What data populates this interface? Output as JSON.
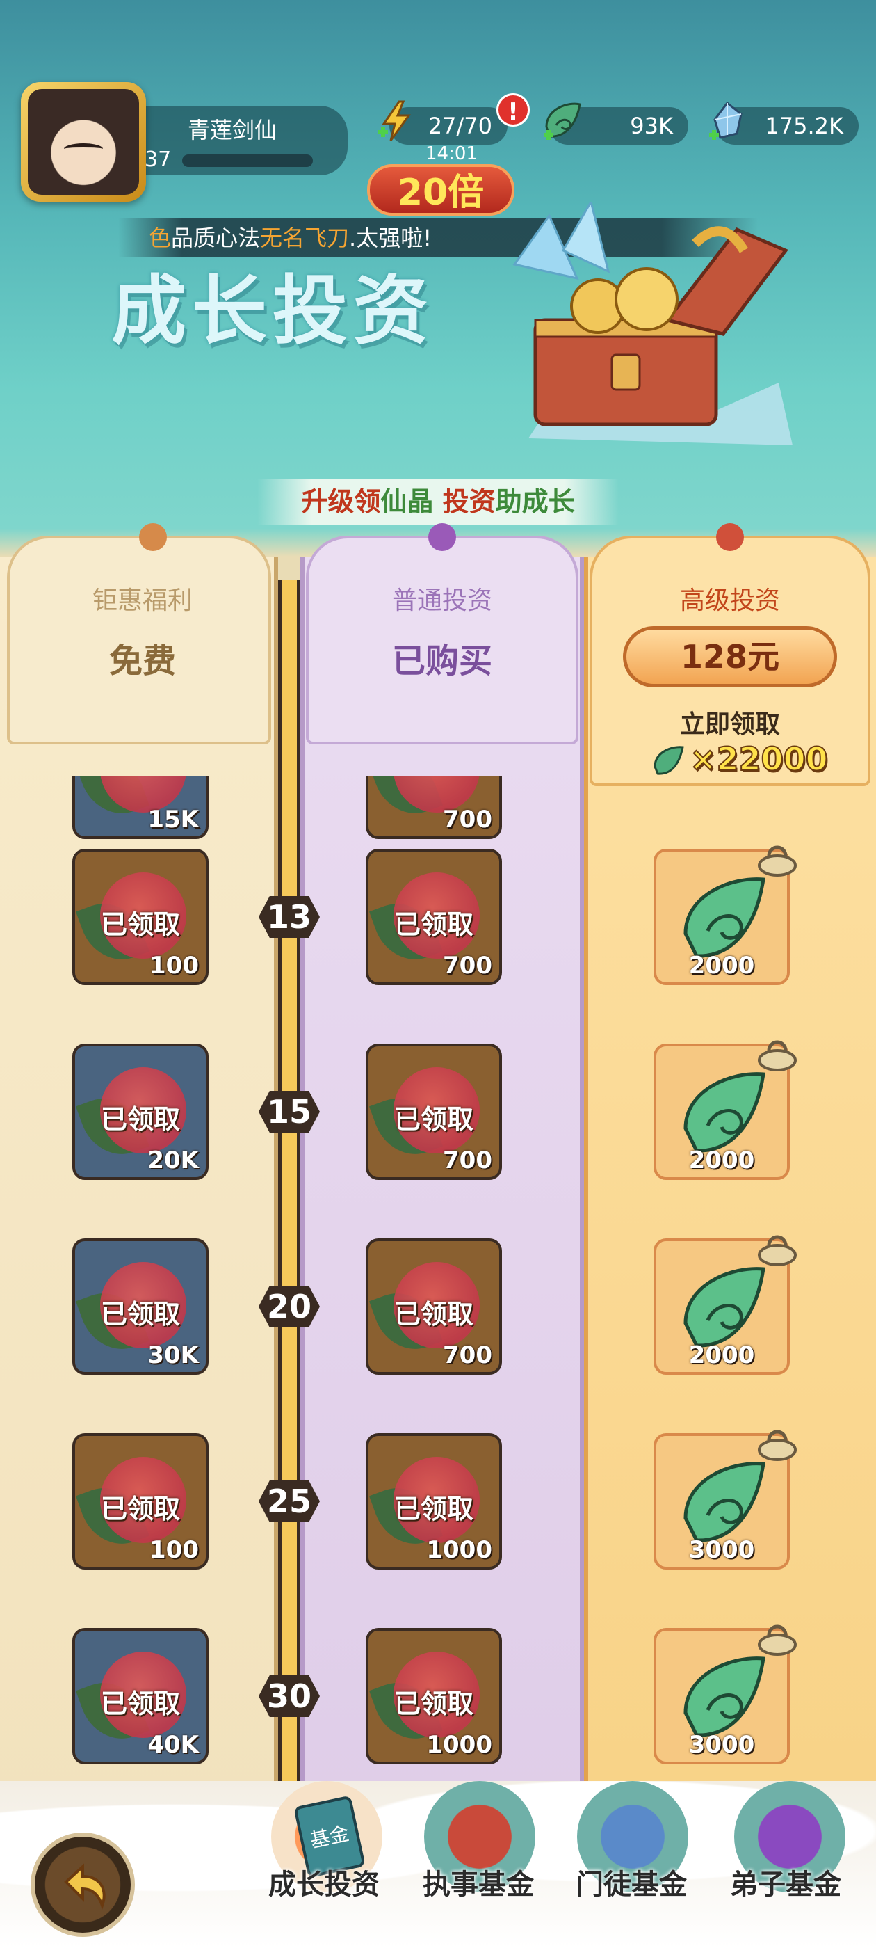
{
  "player": {
    "name": "青莲剑仙",
    "level": "37"
  },
  "resources": {
    "stamina": "27/70",
    "green": "93K",
    "crystal": "175.2K",
    "alert": "!"
  },
  "event": {
    "timer": "14:01",
    "multiplier": "20倍"
  },
  "marquee": {
    "part1": "色",
    "part2": "品质心法",
    "part3": "无名飞刀",
    "part4": ".太强啦!"
  },
  "banner": {
    "title": "成长投资"
  },
  "slogan": {
    "part1": "升级领",
    "part2": "仙晶",
    "part3": " 投资",
    "part4": "助成长"
  },
  "columns": {
    "free": {
      "title": "钜惠福利",
      "status": "免费"
    },
    "normal": {
      "title": "普通投资",
      "status": "已购买"
    },
    "premium": {
      "title": "高级投资",
      "price": "128元",
      "claim_label": "立即领取",
      "claim_amount": "×22000"
    }
  },
  "rows": [
    {
      "level": "",
      "free": {
        "label": "",
        "amount": "15K",
        "style": "blue"
      },
      "normal": {
        "label": "",
        "amount": "700"
      },
      "premium": {
        "amount": ""
      }
    },
    {
      "level": "13",
      "free": {
        "label": "已领取",
        "amount": "100",
        "style": "brown"
      },
      "normal": {
        "label": "已领取",
        "amount": "700"
      },
      "premium": {
        "amount": "2000"
      }
    },
    {
      "level": "15",
      "free": {
        "label": "已领取",
        "amount": "20K",
        "style": "blue"
      },
      "normal": {
        "label": "已领取",
        "amount": "700"
      },
      "premium": {
        "amount": "2000"
      }
    },
    {
      "level": "20",
      "free": {
        "label": "已领取",
        "amount": "30K",
        "style": "blue"
      },
      "normal": {
        "label": "已领取",
        "amount": "700"
      },
      "premium": {
        "amount": "2000"
      }
    },
    {
      "level": "25",
      "free": {
        "label": "已领取",
        "amount": "100",
        "style": "brown"
      },
      "normal": {
        "label": "已领取",
        "amount": "1000"
      },
      "premium": {
        "amount": "3000"
      }
    },
    {
      "level": "30",
      "free": {
        "label": "已领取",
        "amount": "40K",
        "style": "blue"
      },
      "normal": {
        "label": "已领取",
        "amount": "1000"
      },
      "premium": {
        "amount": "3000"
      }
    }
  ],
  "nav": {
    "growth_badge": "基金",
    "growth": "成长投资",
    "steward": "执事基金",
    "apprentice": "门徒基金",
    "disciple": "弟子基金"
  },
  "colors": {
    "accent_red": "#c0371d",
    "accent_green": "#3d8a3a",
    "premium_orange": "#f2a452",
    "normal_purple": "#9b74b8"
  }
}
